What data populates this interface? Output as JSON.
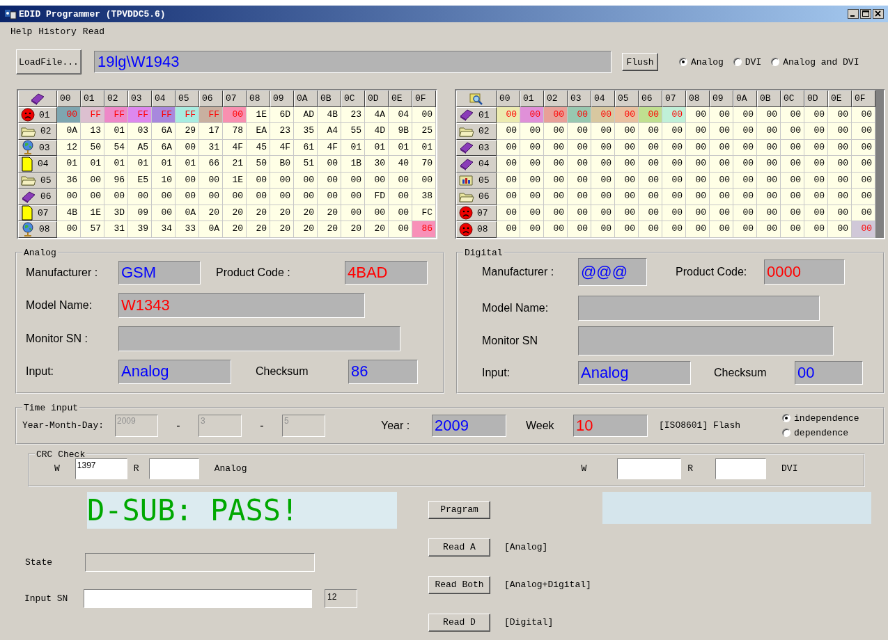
{
  "window": {
    "title": "EDID Programmer (TPVDDC5.6)"
  },
  "menu": [
    "Help",
    "History",
    "Read"
  ],
  "load_button": "LoadFile...",
  "file_path": "19lg\\W1943",
  "flush_button": "Flush",
  "modes": [
    {
      "label": "Analog",
      "selected": true
    },
    {
      "label": "DVI",
      "selected": false
    },
    {
      "label": "Analog and DVI",
      "selected": false
    }
  ],
  "grids": [
    {
      "corner": {
        "kind": "book"
      },
      "columns": [
        "00",
        "01",
        "02",
        "03",
        "04",
        "05",
        "06",
        "07",
        "08",
        "09",
        "0A",
        "0B",
        "0C",
        "0D",
        "0E",
        "0F"
      ],
      "rows": [
        {
          "label": "01",
          "kind": "alert",
          "cells": [
            {
              "value": "00",
              "color": "#7ea6b0"
            },
            {
              "value": "FF",
              "color": "#dcc0d0"
            },
            {
              "value": "FF",
              "color": "#ee88c8"
            },
            {
              "value": "FF",
              "color": "#dd88ee"
            },
            {
              "value": "FF",
              "color": "#a888dd"
            },
            {
              "value": "FF",
              "color": "#a8ece0"
            },
            {
              "value": "FF",
              "color": "#c8b0a0"
            },
            {
              "value": "00",
              "color": "#f890b0"
            },
            "1E",
            "6D",
            "AD",
            "4B",
            "23",
            "4A",
            "04",
            "00"
          ]
        },
        {
          "label": "02",
          "kind": "folder",
          "cells": [
            "0A",
            "13",
            "01",
            "03",
            "6A",
            "29",
            "17",
            "78",
            "EA",
            "23",
            "35",
            "A4",
            "55",
            "4D",
            "9B",
            "25"
          ]
        },
        {
          "label": "03",
          "kind": "globe",
          "cells": [
            "12",
            "50",
            "54",
            "A5",
            "6A",
            "00",
            "31",
            "4F",
            "45",
            "4F",
            "61",
            "4F",
            "01",
            "01",
            "01",
            "01"
          ]
        },
        {
          "label": "04",
          "kind": "page",
          "cells": [
            "01",
            "01",
            "01",
            "01",
            "01",
            "01",
            "66",
            "21",
            "50",
            "B0",
            "51",
            "00",
            "1B",
            "30",
            "40",
            "70"
          ]
        },
        {
          "label": "05",
          "kind": "folder",
          "cells": [
            "36",
            "00",
            "96",
            "E5",
            "10",
            "00",
            "00",
            "1E",
            "00",
            "00",
            "00",
            "00",
            "00",
            "00",
            "00",
            "00"
          ]
        },
        {
          "label": "06",
          "kind": "book",
          "cells": [
            "00",
            "00",
            "00",
            "00",
            "00",
            "00",
            "00",
            "00",
            "00",
            "00",
            "00",
            "00",
            "00",
            "FD",
            "00",
            "38"
          ]
        },
        {
          "label": "07",
          "kind": "page",
          "cells": [
            "4B",
            "1E",
            "3D",
            "09",
            "00",
            "0A",
            "20",
            "20",
            "20",
            "20",
            "20",
            "20",
            "00",
            "00",
            "00",
            "FC"
          ]
        },
        {
          "label": "08",
          "kind": "globe",
          "cells": [
            "00",
            "57",
            "31",
            "39",
            "34",
            "33",
            "0A",
            "20",
            "20",
            "20",
            "20",
            "20",
            "20",
            "20",
            "00",
            {
              "value": "86",
              "color": "#f890b8"
            }
          ]
        }
      ]
    },
    {
      "corner": {
        "kind": "search"
      },
      "columns": [
        "00",
        "01",
        "02",
        "03",
        "04",
        "05",
        "06",
        "07",
        "08",
        "09",
        "0A",
        "0B",
        "0C",
        "0D",
        "0E",
        "0F"
      ],
      "rows": [
        {
          "label": "01",
          "kind": "book",
          "cells": [
            {
              "value": "00",
              "color": "#ecebb0"
            },
            {
              "value": "00",
              "color": "#e090d8"
            },
            {
              "value": "00",
              "color": "#e8a098"
            },
            {
              "value": "00",
              "color": "#98c8b0"
            },
            {
              "value": "00",
              "color": "#d8c8a0"
            },
            {
              "value": "00",
              "color": "#e8c0a0"
            },
            {
              "value": "00",
              "color": "#c0e090"
            },
            {
              "value": "00",
              "color": "#c0f0d8"
            },
            "00",
            "00",
            "00",
            "00",
            "00",
            "00",
            "00",
            "00"
          ]
        },
        {
          "label": "02",
          "kind": "folder",
          "cells": [
            "00",
            "00",
            "00",
            "00",
            "00",
            "00",
            "00",
            "00",
            "00",
            "00",
            "00",
            "00",
            "00",
            "00",
            "00",
            "00"
          ]
        },
        {
          "label": "03",
          "kind": "book",
          "cells": [
            "00",
            "00",
            "00",
            "00",
            "00",
            "00",
            "00",
            "00",
            "00",
            "00",
            "00",
            "00",
            "00",
            "00",
            "00",
            "00"
          ]
        },
        {
          "label": "04",
          "kind": "book",
          "cells": [
            "00",
            "00",
            "00",
            "00",
            "00",
            "00",
            "00",
            "00",
            "00",
            "00",
            "00",
            "00",
            "00",
            "00",
            "00",
            "00"
          ]
        },
        {
          "label": "05",
          "kind": "chart",
          "cells": [
            "00",
            "00",
            "00",
            "00",
            "00",
            "00",
            "00",
            "00",
            "00",
            "00",
            "00",
            "00",
            "00",
            "00",
            "00",
            "00"
          ]
        },
        {
          "label": "06",
          "kind": "folder",
          "cells": [
            "00",
            "00",
            "00",
            "00",
            "00",
            "00",
            "00",
            "00",
            "00",
            "00",
            "00",
            "00",
            "00",
            "00",
            "00",
            "00"
          ]
        },
        {
          "label": "07",
          "kind": "alert",
          "cells": [
            "00",
            "00",
            "00",
            "00",
            "00",
            "00",
            "00",
            "00",
            "00",
            "00",
            "00",
            "00",
            "00",
            "00",
            "00",
            "00"
          ]
        },
        {
          "label": "08",
          "kind": "alert",
          "cells": [
            "00",
            "00",
            "00",
            "00",
            "00",
            "00",
            "00",
            "00",
            "00",
            "00",
            "00",
            "00",
            "00",
            "00",
            "00",
            {
              "value": "00",
              "color": "#d0c8d8"
            }
          ]
        }
      ]
    }
  ],
  "panels": [
    {
      "title": "Analog",
      "rows": [
        [
          {
            "label": "Manufacturer :",
            "value": "GSM",
            "color": "#0000ff"
          },
          {
            "label": "Product Code :",
            "value": "4BAD",
            "color": "#ff0000"
          }
        ],
        [
          {
            "label": "Model Name:",
            "value": "W1343",
            "color": "#ff0000"
          }
        ],
        [
          {
            "label": "Monitor SN :"
          }
        ],
        [
          {
            "label": "Input:",
            "value": "Analog",
            "color": "#0000ff"
          },
          {
            "label": "Checksum",
            "value": "86",
            "color": "#0000ff"
          }
        ]
      ]
    },
    {
      "title": "Digital",
      "rows": [
        [
          {
            "label": "Manufacturer :",
            "value": "@@@",
            "color": "#0000ff"
          },
          {
            "label": "Product Code:",
            "value": "0000",
            "color": "#ff0000"
          }
        ],
        [
          {
            "label": "Model Name:"
          }
        ],
        [
          {
            "label": "Monitor SN"
          }
        ],
        [
          {
            "label": "Input:",
            "value": "Analog",
            "color": "#0000ff"
          },
          {
            "label": "Checksum",
            "value": "00",
            "color": "#0000ff"
          }
        ]
      ]
    }
  ],
  "time_input": {
    "title": "Time input",
    "date_label": "Year-Month-Day:",
    "date_fields": [
      {
        "value": "2009",
        "disabled": true
      },
      {
        "value": "3",
        "disabled": true
      },
      {
        "value": "5",
        "disabled": true
      }
    ],
    "separators": [
      "-",
      "-"
    ],
    "year_label": "Year :",
    "year": {
      "value": "2009",
      "color": "#0000ff"
    },
    "week_label": "Week",
    "week": {
      "value": "10",
      "color": "#ff0000"
    },
    "iso_text": "[ISO8601]  Flash",
    "flash_options": [
      {
        "label": "independence",
        "selected": true
      },
      {
        "label": "dependence",
        "selected": false
      }
    ]
  },
  "crc_check": {
    "title": "CRC Check",
    "groups": [
      {
        "w_label": "W",
        "w": "1397",
        "r_label": "R",
        "name": "Analog"
      },
      {
        "w_label": "W",
        "r_label": "R",
        "name": "DVI"
      }
    ]
  },
  "pass_message": {
    "text": "D-SUB: PASS!",
    "color": "#00a800"
  },
  "program_button": "Pragram",
  "read_buttons": [
    {
      "label": "Read A",
      "note": "[Analog]"
    },
    {
      "label": "Read Both",
      "note": "[Analog+Digital]"
    },
    {
      "label": "Read D",
      "note": "[Digital]"
    }
  ],
  "state_label": "State",
  "input_sn_label": "Input SN",
  "sn_count": "12"
}
